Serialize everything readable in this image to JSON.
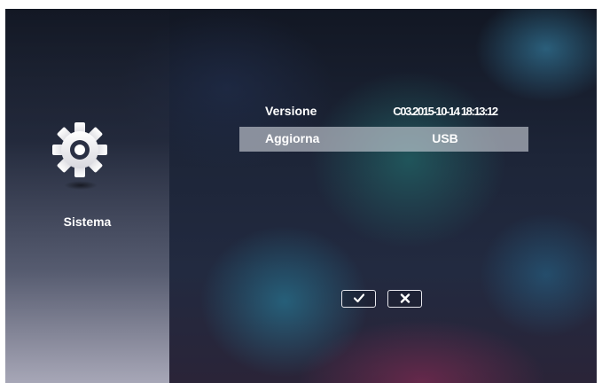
{
  "sidebar": {
    "icon": "gear-icon",
    "label": "Sistema"
  },
  "rows": [
    {
      "label": "Versione",
      "value": "C03.2015-10-14 18:13:12"
    },
    {
      "label": "Aggiorna",
      "value": "USB"
    }
  ],
  "buttons": {
    "confirm_icon": "check-icon",
    "cancel_icon": "x-icon"
  },
  "colors": {
    "highlight_row": "#cdd2da",
    "text": "#ffffff"
  }
}
